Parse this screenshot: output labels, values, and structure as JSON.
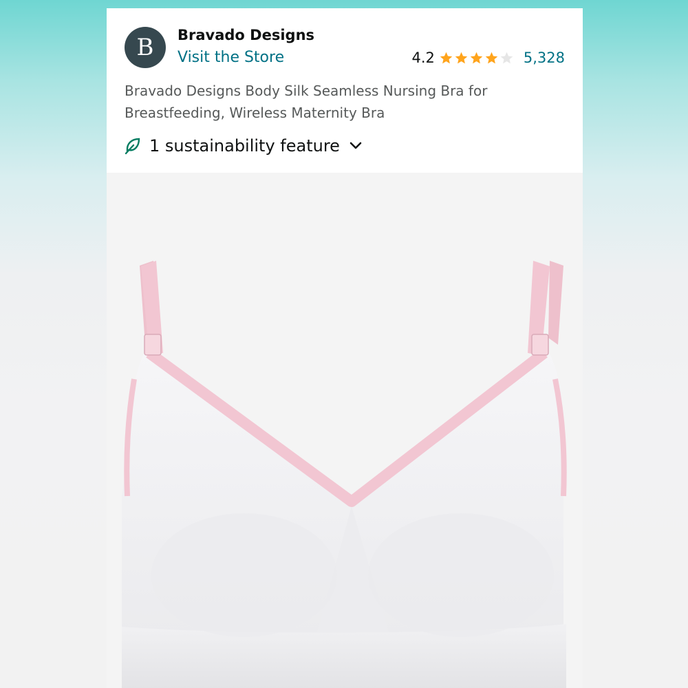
{
  "store": {
    "brand_name": "Bravado Designs",
    "visit_store": "Visit the Store",
    "logo_letter": "B"
  },
  "rating": {
    "value": "4.2",
    "stars": 4.2,
    "review_count": "5,328"
  },
  "product": {
    "title": "Bravado Designs Body Silk Seamless Nursing Bra for Breastfeeding, Wireless Maternity Bra",
    "image_subject": "white seamless nursing bra with pink straps and clips"
  },
  "sustainability": {
    "label": "1 sustainability feature",
    "icon": "leaf-icon",
    "toggle_icon": "chevron-down-icon"
  },
  "colors": {
    "link": "#007185",
    "star": "#ffa41c",
    "leaf": "#067d62",
    "logo_bg": "#36484f",
    "strap_pink": "#f2c6d2"
  }
}
